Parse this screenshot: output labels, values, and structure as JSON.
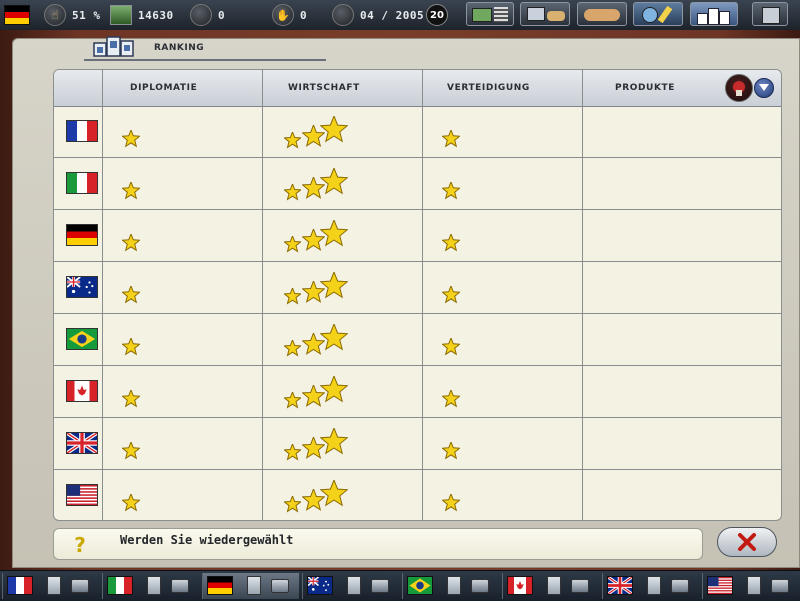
{
  "topbar": {
    "approval": "51 %",
    "money": "14630",
    "loans": "0",
    "trade": "0",
    "date": "04 / 2005",
    "round_badge": "20"
  },
  "tab": {
    "label": "RANKING"
  },
  "table": {
    "columns": [
      "DIPLOMATIE",
      "WIRTSCHAFT",
      "VERTEIDIGUNG",
      "PRODUKTE"
    ],
    "rows": [
      {
        "country": "france",
        "diplomatie": 1,
        "wirtschaft": 3,
        "verteidigung": 1,
        "produkte": 0
      },
      {
        "country": "italy",
        "diplomatie": 1,
        "wirtschaft": 3,
        "verteidigung": 1,
        "produkte": 0
      },
      {
        "country": "germany",
        "diplomatie": 1,
        "wirtschaft": 3,
        "verteidigung": 1,
        "produkte": 0
      },
      {
        "country": "australia",
        "diplomatie": 1,
        "wirtschaft": 3,
        "verteidigung": 1,
        "produkte": 0
      },
      {
        "country": "brazil",
        "diplomatie": 1,
        "wirtschaft": 3,
        "verteidigung": 1,
        "produkte": 0
      },
      {
        "country": "canada",
        "diplomatie": 1,
        "wirtschaft": 3,
        "verteidigung": 1,
        "produkte": 0
      },
      {
        "country": "united-kingdom",
        "diplomatie": 1,
        "wirtschaft": 3,
        "verteidigung": 1,
        "produkte": 0
      },
      {
        "country": "usa",
        "diplomatie": 1,
        "wirtschaft": 3,
        "verteidigung": 1,
        "produkte": 0
      }
    ]
  },
  "status": {
    "text": "Werden Sie wiedergewählt"
  },
  "bottombar": {
    "countries": [
      "france",
      "italy",
      "germany",
      "australia",
      "brazil",
      "canada",
      "united-kingdom",
      "usa"
    ],
    "active": "germany"
  },
  "icons": {
    "help": "question-mark-icon",
    "close": "close-x-icon",
    "star": "star-icon"
  },
  "colors": {
    "star_fill": "#f5d21a",
    "star_stroke": "#8a6a00",
    "close_x": "#c21a12",
    "table_bg": "#f4f2e3"
  }
}
